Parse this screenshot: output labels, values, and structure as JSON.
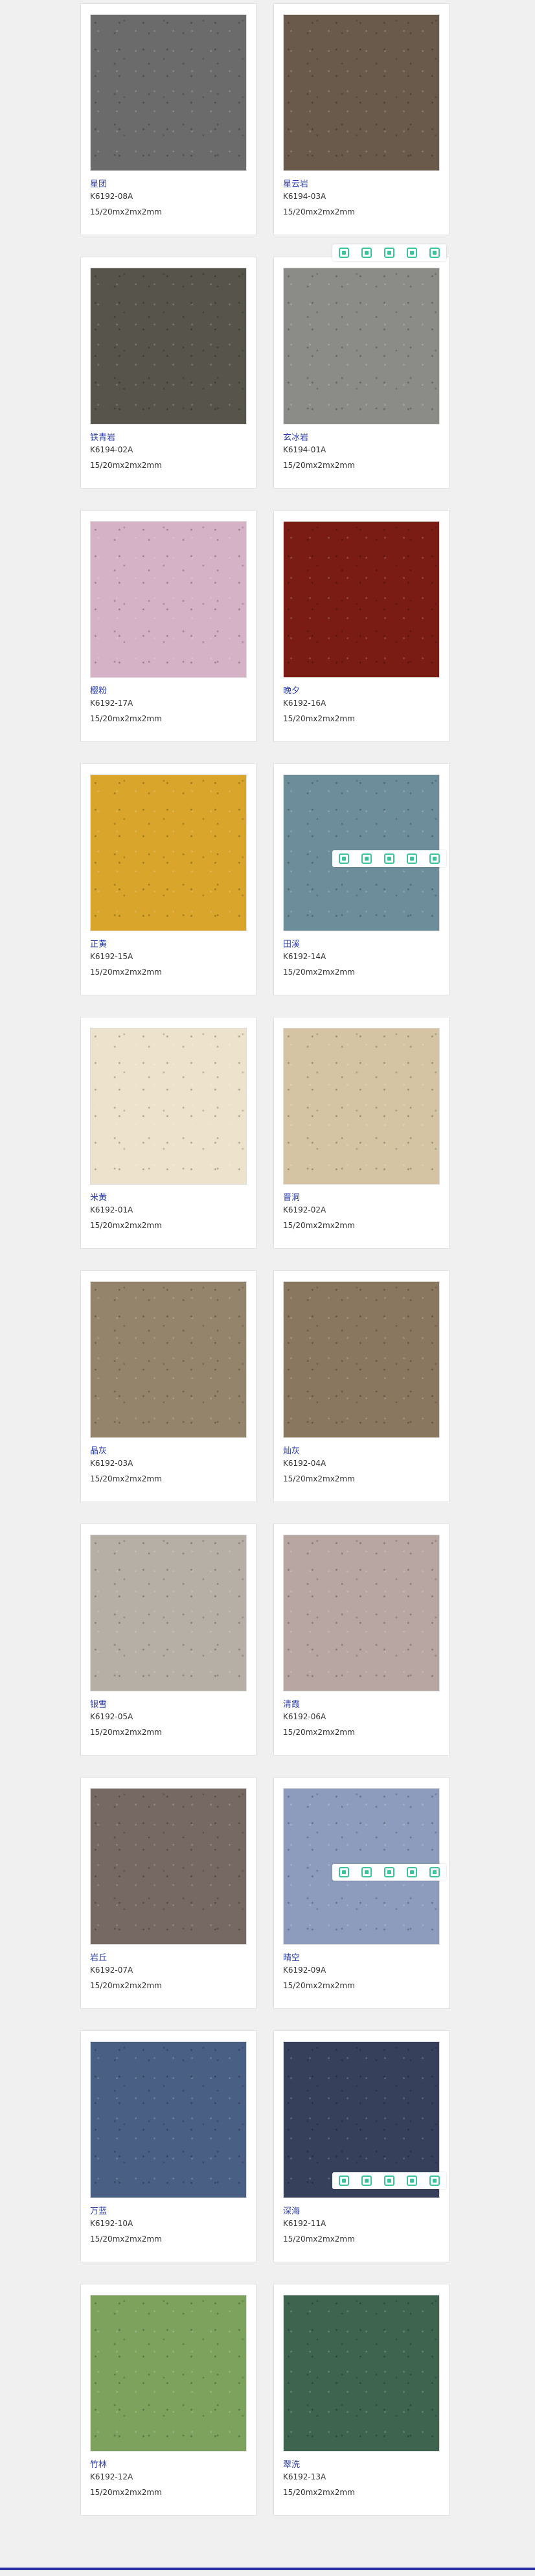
{
  "colors": {
    "accent": "#2c3fa8",
    "tool": "#39c49a",
    "footer": "#2b2fa3"
  },
  "toolbar_icons": [
    "bookmark-icon",
    "expand-icon",
    "save-icon",
    "share-icon",
    "settings-icon"
  ],
  "products": [
    {
      "name": "星团",
      "code": "K6192-08A",
      "spec": "15/20mx2mx2mm",
      "color": "#6b6b6b"
    },
    {
      "name": "星云岩",
      "code": "K6194-03A",
      "spec": "15/20mx2mx2mm",
      "color": "#6a5a4b"
    },
    {
      "name": "铁青岩",
      "code": "K6194-02A",
      "spec": "15/20mx2mx2mm",
      "color": "#56544b"
    },
    {
      "name": "玄冰岩",
      "code": "K6194-01A",
      "spec": "15/20mx2mx2mm",
      "color": "#8b8c88"
    },
    {
      "name": "樱粉",
      "code": "K6192-17A",
      "spec": "15/20mx2mx2mm",
      "color": "#d6b2c6"
    },
    {
      "name": "晚夕",
      "code": "K6192-16A",
      "spec": "15/20mx2mx2mm",
      "color": "#7a1c14"
    },
    {
      "name": "正黄",
      "code": "K6192-15A",
      "spec": "15/20mx2mx2mm",
      "color": "#d9a52b"
    },
    {
      "name": "田溪",
      "code": "K6192-14A",
      "spec": "15/20mx2mx2mm",
      "color": "#6d8d9b"
    },
    {
      "name": "米黄",
      "code": "K6192-01A",
      "spec": "15/20mx2mx2mm",
      "color": "#ede3cc"
    },
    {
      "name": "晋洞",
      "code": "K6192-02A",
      "spec": "15/20mx2mx2mm",
      "color": "#d5c4a4"
    },
    {
      "name": "晶灰",
      "code": "K6192-03A",
      "spec": "15/20mx2mx2mm",
      "color": "#94846b"
    },
    {
      "name": "灿灰",
      "code": "K6192-04A",
      "spec": "15/20mx2mx2mm",
      "color": "#8a7760"
    },
    {
      "name": "银雪",
      "code": "K6192-05A",
      "spec": "15/20mx2mx2mm",
      "color": "#b6afa6"
    },
    {
      "name": "清霞",
      "code": "K6192-06A",
      "spec": "15/20mx2mx2mm",
      "color": "#b7a6a1"
    },
    {
      "name": "岩丘",
      "code": "K6192-07A",
      "spec": "15/20mx2mx2mm",
      "color": "#766862"
    },
    {
      "name": "晴空",
      "code": "K6192-09A",
      "spec": "15/20mx2mx2mm",
      "color": "#8d9bbc"
    },
    {
      "name": "万蓝",
      "code": "K6192-10A",
      "spec": "15/20mx2mx2mm",
      "color": "#4a5f84"
    },
    {
      "name": "深海",
      "code": "K6192-11A",
      "spec": "15/20mx2mx2mm",
      "color": "#36405b"
    },
    {
      "name": "竹林",
      "code": "K6192-12A",
      "spec": "15/20mx2mx2mm",
      "color": "#7da25e"
    },
    {
      "name": "翠洗",
      "code": "K6192-13A",
      "spec": "15/20mx2mx2mm",
      "color": "#3e6450"
    }
  ]
}
